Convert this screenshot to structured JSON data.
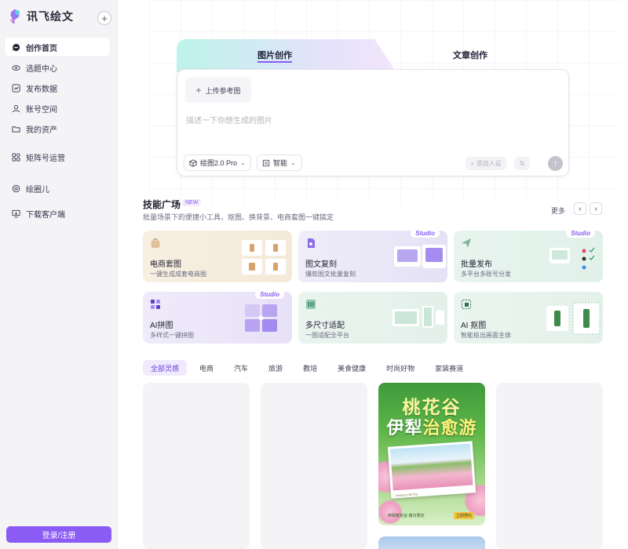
{
  "brand": {
    "name": "讯飞绘文",
    "logo_icon": "brand-logo-icon"
  },
  "sidebar": {
    "add_label": "+",
    "items": [
      {
        "label": "创作首页",
        "icon": "message-icon",
        "active": true
      },
      {
        "label": "选题中心",
        "icon": "eye-icon"
      },
      {
        "label": "发布数据",
        "icon": "chart-icon"
      },
      {
        "label": "账号空间",
        "icon": "user-icon"
      },
      {
        "label": "我的资产",
        "icon": "folder-icon"
      },
      {
        "label": "矩阵号运营",
        "icon": "matrix-icon"
      },
      {
        "label": "绘圈儿",
        "icon": "circle-icon"
      },
      {
        "label": "下载客户端",
        "icon": "download-icon"
      }
    ],
    "login_label": "登录/注册"
  },
  "composer": {
    "tabs": [
      {
        "label": "图片创作",
        "active": true
      },
      {
        "label": "文章创作",
        "active": false
      }
    ],
    "upload_ref_label": "上传参考图",
    "prompt_placeholder": "描述一下你想生成的图片",
    "model_label": "绘图2.0 Pro",
    "ratio_label": "智能",
    "add_character_label": "添加人设"
  },
  "skills": {
    "title": "技能广场",
    "new_badge": "NEW",
    "subtitle": "批量场景下的便捷小工具，抠图、换背景、电商套图一键搞定",
    "more_label": "更多",
    "cards": [
      {
        "title": "电商套图",
        "sub": "一键生成成套电商图",
        "studio": ""
      },
      {
        "title": "图文复刻",
        "sub": "爆款图文批量复刻",
        "studio": "Studio"
      },
      {
        "title": "批量发布",
        "sub": "多平台多账号分发",
        "studio": "Studio"
      },
      {
        "title": "AI拼图",
        "sub": "多样式一键拼图",
        "studio": "Studio"
      },
      {
        "title": "多尺寸适配",
        "sub": "一图适配全平台",
        "studio": ""
      },
      {
        "title": "AI 抠图",
        "sub": "智能抠出画面主体",
        "studio": ""
      }
    ]
  },
  "filters": [
    "全部灵感",
    "电商",
    "汽车",
    "旅游",
    "教培",
    "美食健康",
    "时尚好物",
    "家装赛道"
  ],
  "gallery": {
    "poster": {
      "title_line1": "桃花谷",
      "title_line2_a": "伊犁",
      "title_line2_b": "治愈游",
      "caption": "Healing Hill Trip",
      "footer": "伊犁桃花谷·春日限定",
      "tag": "立即预约"
    }
  },
  "colors": {
    "accent": "#8a5cf5",
    "sidebar_bg": "#f4f4f7"
  }
}
